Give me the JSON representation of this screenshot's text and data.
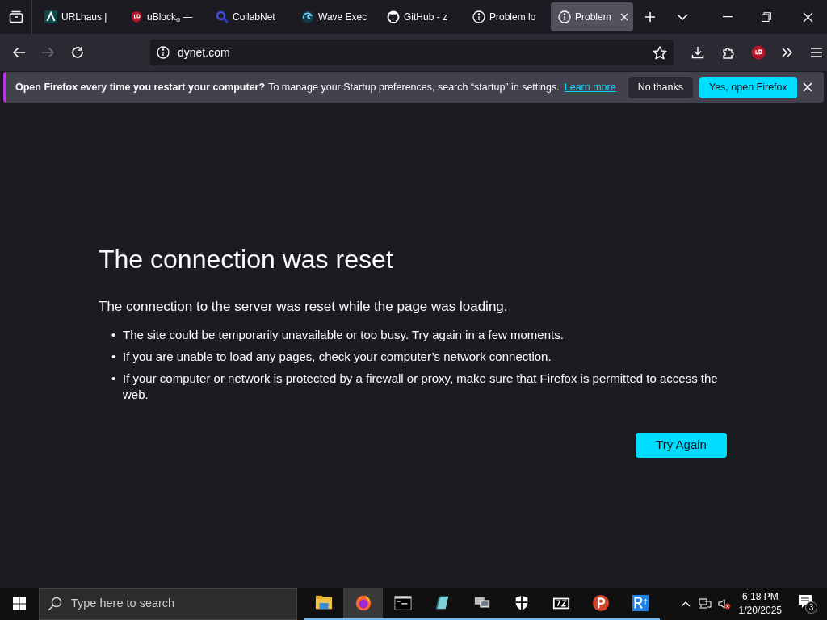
{
  "tabs": [
    {
      "title": "URLhaus |",
      "kind": "urlhaus",
      "selected": false
    },
    {
      "title": "uBlock$_{o}$ —",
      "kind": "ublock",
      "selected": false
    },
    {
      "title": "CollabNet",
      "kind": "search",
      "selected": false
    },
    {
      "title": "Wave Exec",
      "kind": "wave",
      "selected": false
    },
    {
      "title": "GitHub - z",
      "kind": "github",
      "selected": false
    },
    {
      "title": "Problem lo",
      "kind": "info",
      "selected": false
    },
    {
      "title": "Problem",
      "kind": "info",
      "selected": true
    }
  ],
  "address": {
    "url": "dynet.com"
  },
  "notification": {
    "question": "Open Firefox every time you restart your computer?",
    "message": "To manage your Startup preferences, search “startup” in settings.",
    "link": "Learn more",
    "secondary_button": "No thanks",
    "primary_button": "Yes, open Firefox"
  },
  "error_page": {
    "title": "The connection was reset",
    "description": "The connection to the server was reset while the page was loading.",
    "bullets": [
      {
        "marker": "•",
        "text": "The site could be temporarily unavailable or too busy. Try again in a few moments."
      },
      {
        "marker": "•",
        "text": "If you are unable to load any pages, check your computer’s network connection."
      },
      {
        "marker": "•",
        "text": "If your computer or network is protected by a firewall or proxy, make sure that Firefox is permitted to access the web."
      }
    ],
    "button": "Try Again"
  },
  "taskbar": {
    "search_placeholder": "Type here to search",
    "apps": [
      {
        "kind": "folder",
        "running": true,
        "selected": false
      },
      {
        "kind": "firefox",
        "running": true,
        "selected": true
      },
      {
        "kind": "terminal",
        "running": true,
        "selected": false
      },
      {
        "kind": "notepad",
        "running": true,
        "selected": false
      },
      {
        "kind": "network",
        "running": true,
        "selected": false
      },
      {
        "kind": "shield",
        "running": true,
        "selected": false
      },
      {
        "kind": "archive",
        "running": true,
        "selected": false
      },
      {
        "kind": "psiphon",
        "running": true,
        "selected": false
      },
      {
        "kind": "regshot",
        "running": true,
        "selected": false
      }
    ],
    "time": "6:18 PM",
    "date": "1/20/2025",
    "notification_count": "3"
  }
}
